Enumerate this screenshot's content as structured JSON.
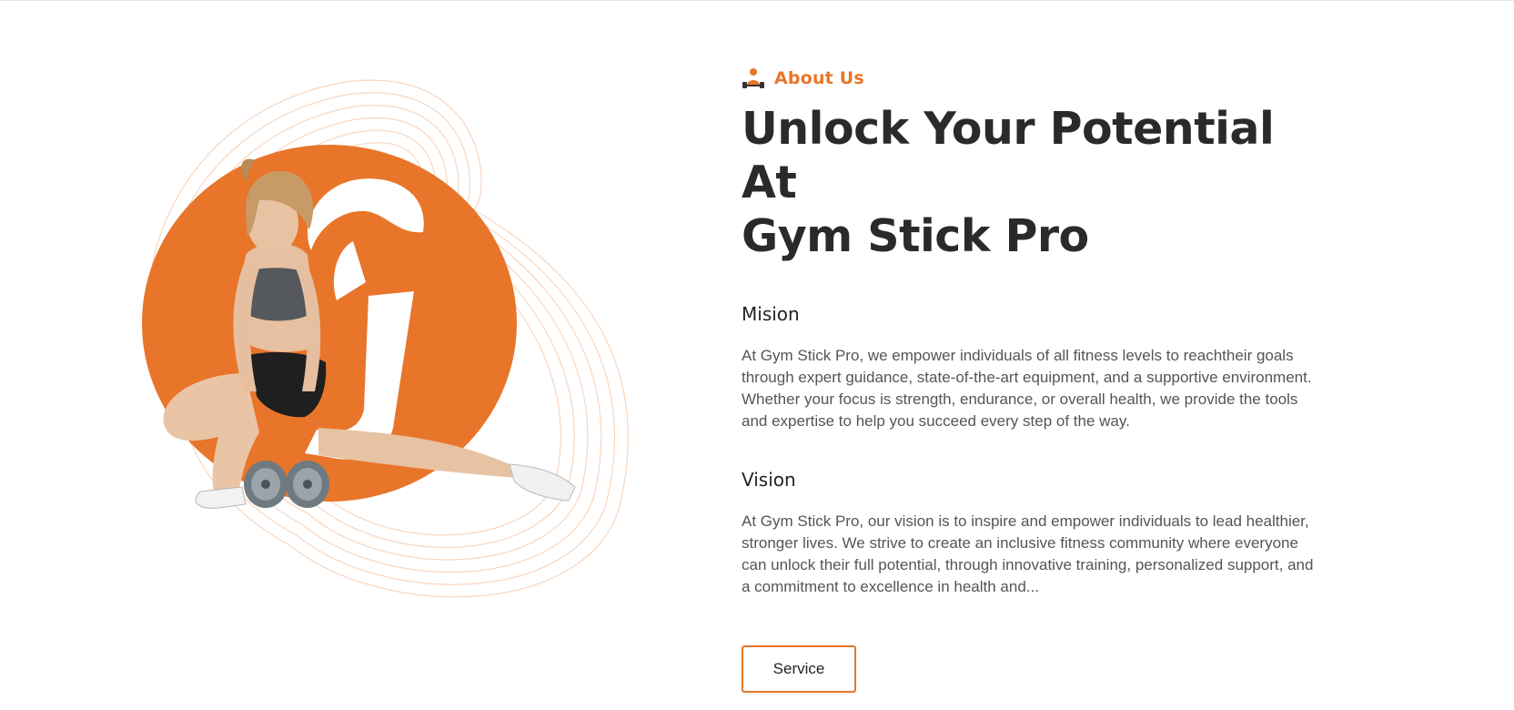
{
  "about": {
    "eyebrow_label": "About Us",
    "eyebrow_icon": "dumbbell-lifter-icon",
    "title_line1": "Unlock Your Potential At",
    "title_line2": "Gym Stick Pro"
  },
  "mission": {
    "heading": "Mision",
    "text": "At Gym Stick Pro, we empower individuals of all fitness levels to reachtheir goals through expert guidance, state-of-the-art equipment, and a supportive environment. Whether your focus is strength, endurance, or overall health, we provide the tools and expertise to help you succeed every step of the way."
  },
  "vision": {
    "heading": "Vision",
    "text": "At Gym Stick Pro, our vision is to inspire and empower individuals to lead healthier, stronger lives. We strive to create an inclusive fitness community where everyone can unlock their full potential, through innovative training, personalized support, and a commitment to excellence in health and..."
  },
  "cta": {
    "service_label": "Service"
  },
  "colors": {
    "accent": "#e8752a",
    "text_dark": "#2a2a2a",
    "text_body": "#555555"
  }
}
